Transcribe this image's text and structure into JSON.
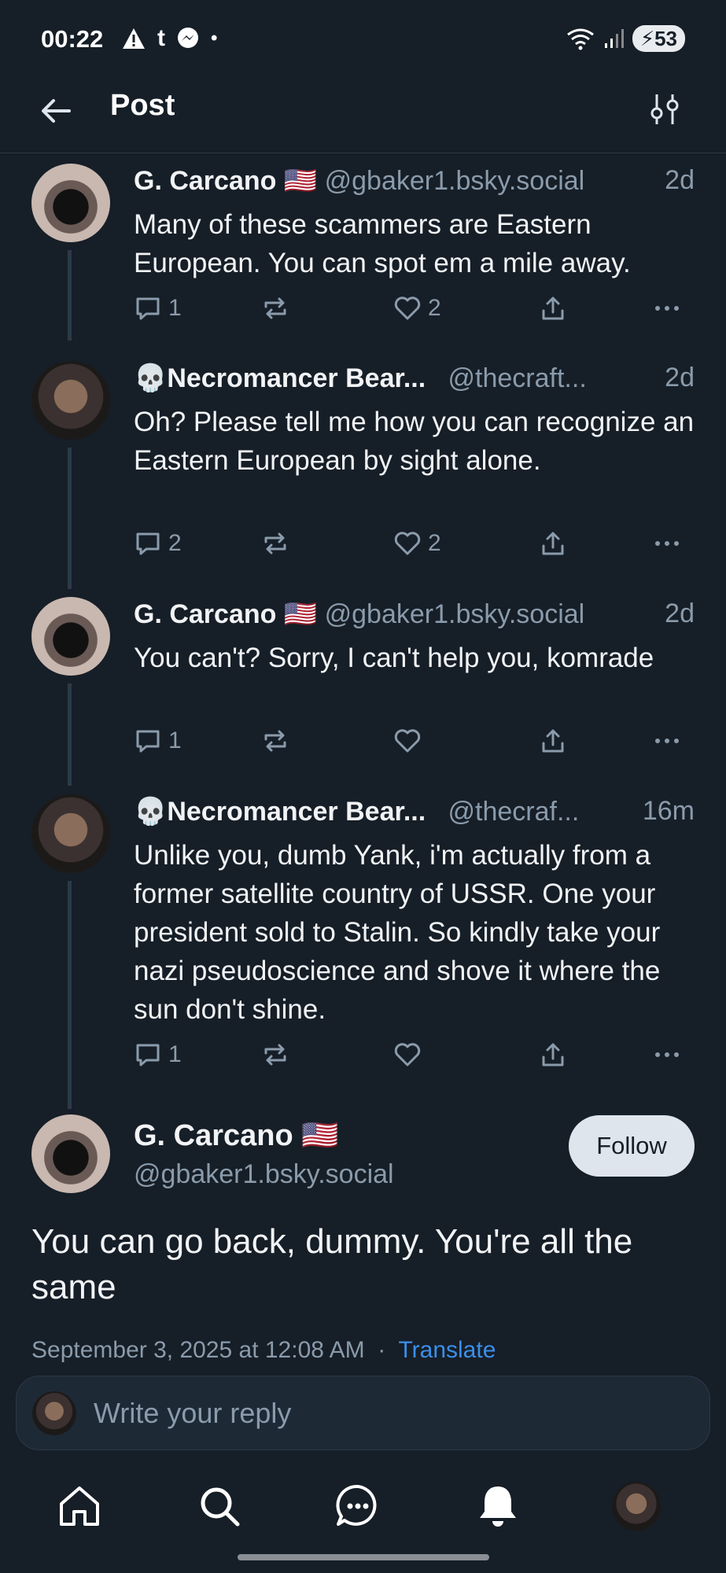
{
  "status_bar": {
    "time": "00:22",
    "battery": "53"
  },
  "header": {
    "title": "Post"
  },
  "thread": [
    {
      "author": "G. Carcano 🇺🇸",
      "handle": "@gbaker1.bsky.social",
      "time": "2d",
      "text": "Many of these scammers are Eastern European. You can spot em a mile away.",
      "replies": "1",
      "likes": "2",
      "avatar": "cat"
    },
    {
      "author": "💀Necromancer Bear...",
      "handle": "@thecraft...",
      "time": "2d",
      "text": "Oh? Please tell me how you can recognize an Eastern European by sight alone.",
      "replies": "2",
      "likes": "2",
      "avatar": "bear"
    },
    {
      "author": "G. Carcano 🇺🇸",
      "handle": "@gbaker1.bsky.social",
      "time": "2d",
      "text": "You can't? Sorry, I can't help you, komrade",
      "replies": "1",
      "likes": "",
      "avatar": "cat"
    },
    {
      "author": "💀Necromancer Bear...",
      "handle": "@thecraf...",
      "time": "16m",
      "text": "Unlike you, dumb Yank, i'm actually from a former satellite country of USSR. One your president sold to Stalin. So kindly take your nazi pseudoscience and shove it where the sun don't shine.",
      "replies": "1",
      "likes": "",
      "avatar": "bear"
    }
  ],
  "main_post": {
    "author": "G. Carcano 🇺🇸",
    "handle": "@gbaker1.bsky.social",
    "follow_label": "Follow",
    "text": "You can go back, dummy. You're all the same",
    "timestamp": "September 3, 2025 at 12:08 AM",
    "separator": "·",
    "translate_label": "Translate"
  },
  "reply": {
    "placeholder": "Write your reply"
  },
  "tabs": [
    "home",
    "search",
    "chat",
    "notifications",
    "profile"
  ],
  "colors": {
    "background": "#161e27",
    "accent": "#3b8fea",
    "muted": "#8a9bab"
  }
}
